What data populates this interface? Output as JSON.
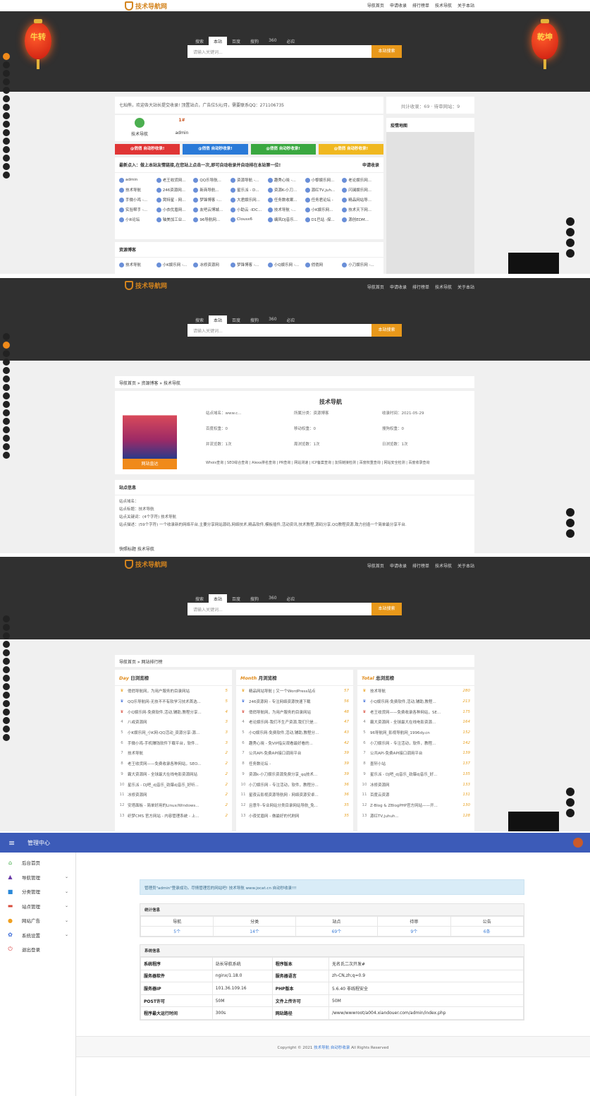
{
  "front": {
    "logo": "技术导航网",
    "nav": [
      "导航首页",
      "申请收录",
      "排行榜单",
      "技术导航",
      "关于本站"
    ],
    "search_tabs": [
      "搜索",
      "本站",
      "百度",
      "搜狗",
      "360",
      "必应"
    ],
    "search_placeholder": "请输入关键词...",
    "search_button": "本站搜索",
    "lantern_left": "牛转",
    "lantern_right": "乾坤"
  },
  "home": {
    "notice": "七灿熊，欢迎各大站长提交收录! 顶置站点，广告位5元/月，需要联系QQ：271106735",
    "users": [
      "技术导航",
      "admin"
    ],
    "auto_buttons": [
      "@俏俏 自动秒收录!",
      "@俏俏 自动秒收录!",
      "@俏俏 自动秒收录!",
      "@俏俏 自动秒收录!"
    ],
    "recent_title": "最新点入：做上本站友情链接,在您站上点击一次,即可自动收录并自动排在本站第一位!",
    "apply_label": "申请收录",
    "sites": [
      "admin",
      "老王收货网...",
      "QQ乐导航...",
      "资源导航 -...",
      "趣秀心晓 -...",
      "小黎娱乐网...",
      "老论娱乐网...",
      "技术导航",
      "246资源网...",
      "新商导航...",
      "星乐派 - D...",
      "资源K-小刀...",
      "源红TV,juh...",
      "闪澜娱乐网...",
      "手微小鸡 -...",
      "窝特星 - 网...",
      "梦锋博客 -...",
      "大君娱乐网...",
      "任务数收案...",
      "任务君论坛 -",
      "精品网站导...",
      "实验帮手 -...",
      "小衣优眉网...",
      "友吧云博城...",
      "小助云 -IDC...",
      "技术导航 -...",
      "小K娱乐网...",
      "技术天下网...",
      "小R论坛",
      "轴美加工业...",
      "96导航网...",
      "Clousx6",
      "编风DJ音乐...",
      "D1巴站 -探...",
      "源创EDM..."
    ],
    "resource_title": "资源博客",
    "resource_sites": [
      "技术导航",
      "小K娱乐网 -...",
      "冰修资源网",
      "梦锋博客 -...",
      "小Q娱乐网 -...",
      "俏俏网",
      "小刀娱乐网 -..."
    ],
    "stats_text": "共计收录：69 · 待审网站：9",
    "weather_title": "疫情地图"
  },
  "detail": {
    "breadcrumb": "导航首页 » 资源博客 » 技术导航",
    "site_name": "技术导航",
    "fields": [
      "站点域名：www.c...",
      "所属分类：资源博客",
      "收录时间：2021-05-29",
      "百度权重：0",
      "移动权重：0",
      "搜狗权重：0",
      "并流览数：1次",
      "周浏览数：1次",
      "日浏览数：1次"
    ],
    "visit_button": "网站直达",
    "tools": "Whois查询 | SEO综合查询 | Alexa排名查询 | PR查询 | 网站测速 | ICP备案查询 | 友情链接检测 | 百度权重查询 | 网站安全检测 | 百度收录查询",
    "info_title": "站点信息",
    "info_lines": [
      "站点域名：",
      "站点标题：技术导航",
      "站点关键词：(4个字符) 技术导航",
      "站点描述：(59个字符) 一个收录新的网络平台,主要分享网站源码,网络技术,精品软件,模板插件,活动资讯,技术教程,源码分享,QQ教程资源,致力创造一个简单最分享平台."
    ],
    "related_title": "快照标题 技术导航"
  },
  "ranking": {
    "breadcrumb": "导航首页 » 网站排行榜",
    "cols": [
      {
        "prefix": "Day",
        "title": "日浏览榜",
        "items": [
          [
            "",
            "俏俏导航网，为用户服务的目录网站",
            "5"
          ],
          [
            "",
            "QQ乐导航网-无技不不有软学习技术首选...",
            "5"
          ],
          [
            "",
            "小Q娱乐网-免费软件,活动,辅助,教程分享...",
            "4"
          ],
          [
            "4",
            "八戒资源网",
            "3"
          ],
          [
            "5",
            "小K娱乐网_小K网-QQ活动_资源分享-源...",
            "3"
          ],
          [
            "6",
            "手微小鸡-手机赚钱软件下载平台，软件...",
            "3"
          ],
          [
            "7",
            "技术导航",
            "2"
          ],
          [
            "8",
            "老王收货网——免费收录各种网站，SEO...",
            "2"
          ],
          [
            "9",
            "霸大资源网 - 全球最大在线电影资源网站",
            "2"
          ],
          [
            "10",
            "星乐派 - DJ吧_dj音乐_劲爆dj音乐_好听...",
            "2"
          ],
          [
            "11",
            "冰修资源网",
            "2"
          ],
          [
            "12",
            "安塔面板 - 简单好用的Linux/Windows...",
            "2"
          ],
          [
            "13",
            "织梦CMS 官方网站 - 内容管理系统 - 上...",
            "2"
          ]
        ]
      },
      {
        "prefix": "Month",
        "title": "月浏览榜",
        "items": [
          [
            "",
            "精品网站导航 | 又一个WordPress站点",
            "57"
          ],
          [
            "",
            "246资源网 - 专注网络资源快速下载",
            "56"
          ],
          [
            "",
            "俏俏导航网，为用户服务的目录网站",
            "48"
          ],
          [
            "4",
            "老论娱乐网-我们不生产资源,我们只是...",
            "47"
          ],
          [
            "5",
            "小Q娱乐网-免费软件,活动,辅助,教程分...",
            "43"
          ],
          [
            "6",
            "趣秀心晓 - 免VIP指尖观看最好看的...",
            "42"
          ],
          [
            "7",
            "公共API-免费API接口调用平台",
            "39"
          ],
          [
            "8",
            "任务数论坛 -",
            "39"
          ],
          [
            "9",
            "资源k-小刀娱乐资源免费分享_qq技术...",
            "39"
          ],
          [
            "10",
            "小刀娱乐网 - 专注活动，软件，教程分...",
            "36"
          ],
          [
            "11",
            "星夜云影视资源导航网 - 网络资源安卓...",
            "36"
          ],
          [
            "12",
            "且意牛-专业网站分类目录网站导航_免...",
            "35"
          ],
          [
            "13",
            "小夜优眉网 - 做最好的代刷网",
            "35"
          ]
        ]
      },
      {
        "prefix": "Total",
        "title": "总浏览榜",
        "items": [
          [
            "",
            "技术导航",
            "280"
          ],
          [
            "",
            "小Q娱乐网-免费软件,活动,辅助,教程...",
            "213"
          ],
          [
            "",
            "老王收货网——免费收录各种网站，SE...",
            "175"
          ],
          [
            "4",
            "霸大资源网 - 全球最大在线电影资源...",
            "164"
          ],
          [
            "5",
            "96导航网_影视导航网_1996dy.cn",
            "152"
          ],
          [
            "6",
            "小刀娱乐网 - 专注活动，软件，教程...",
            "142"
          ],
          [
            "7",
            "公共API-免费API接口调用平台",
            "139"
          ],
          [
            "8",
            "墨轩小站",
            "137"
          ],
          [
            "9",
            "星乐派 - DJ吧_dj音乐_劲爆dj音乐_好...",
            "135"
          ],
          [
            "10",
            "冰修资源网",
            "133"
          ],
          [
            "11",
            "百度云资源",
            "131"
          ],
          [
            "12",
            "Z-Blog & ZBlogPHP官方网站——开...",
            "130"
          ],
          [
            "13",
            "源红TV,juhuh...",
            "128"
          ]
        ]
      }
    ]
  },
  "admin": {
    "title": "管理中心",
    "menu": [
      {
        "label": "后台首页",
        "icon": "home-icon",
        "sym": "⌂",
        "color": "#3aa840",
        "sub": false
      },
      {
        "label": "导航管理",
        "icon": "nav-icon",
        "sym": "▲",
        "color": "#6a3aa8",
        "sub": true
      },
      {
        "label": "分类管理",
        "icon": "category-icon",
        "sym": "■",
        "color": "#2a88d8",
        "sub": true
      },
      {
        "label": "站点管理",
        "icon": "site-icon",
        "sym": "▬",
        "color": "#d84a3a",
        "sub": true
      },
      {
        "label": "网站广告",
        "icon": "ad-icon",
        "sym": "●",
        "color": "#f0a020",
        "sub": true
      },
      {
        "label": "系统设置",
        "icon": "gear-icon",
        "sym": "✿",
        "color": "#3a6ad8",
        "sub": true
      },
      {
        "label": "退出登录",
        "icon": "power-icon",
        "sym": "⏻",
        "color": "#d83a3a",
        "sub": false
      }
    ],
    "alert": "管理员\"admin\"登录成功。尽情管理您的网站吧! 技术导航 www.jocat.cn 自动秒收录!!!",
    "stats_title": "统计信息",
    "stats_heads": [
      "导航",
      "分类",
      "站点",
      "待审",
      "公告"
    ],
    "stats_vals": [
      "5个",
      "14个",
      "69个",
      "9个",
      "6条"
    ],
    "sys_title": "系统信息",
    "sys_rows": [
      [
        "系统程序",
        "站长导航系统",
        "程序版本",
        "无名氏二次开发#"
      ],
      [
        "服务器软件",
        "nginx/1.18.0",
        "服务器语言",
        "zh-CN,zh;q=0.9"
      ],
      [
        "服务器IP",
        "101.36.109.16",
        "PHP版本",
        "5.6.40 非线程安全"
      ],
      [
        "POST许可",
        "50M",
        "文件上传许可",
        "50M"
      ],
      [
        "程序最大运行时间",
        "300s",
        "网站路径",
        "/www/wwwroot/a004.xiandouer.com/admin/index.php"
      ]
    ],
    "footer_pre": "Copyright © 2021",
    "footer_link": "技术导航 自动秒收录",
    "footer_post": "All Rights Reserved"
  }
}
